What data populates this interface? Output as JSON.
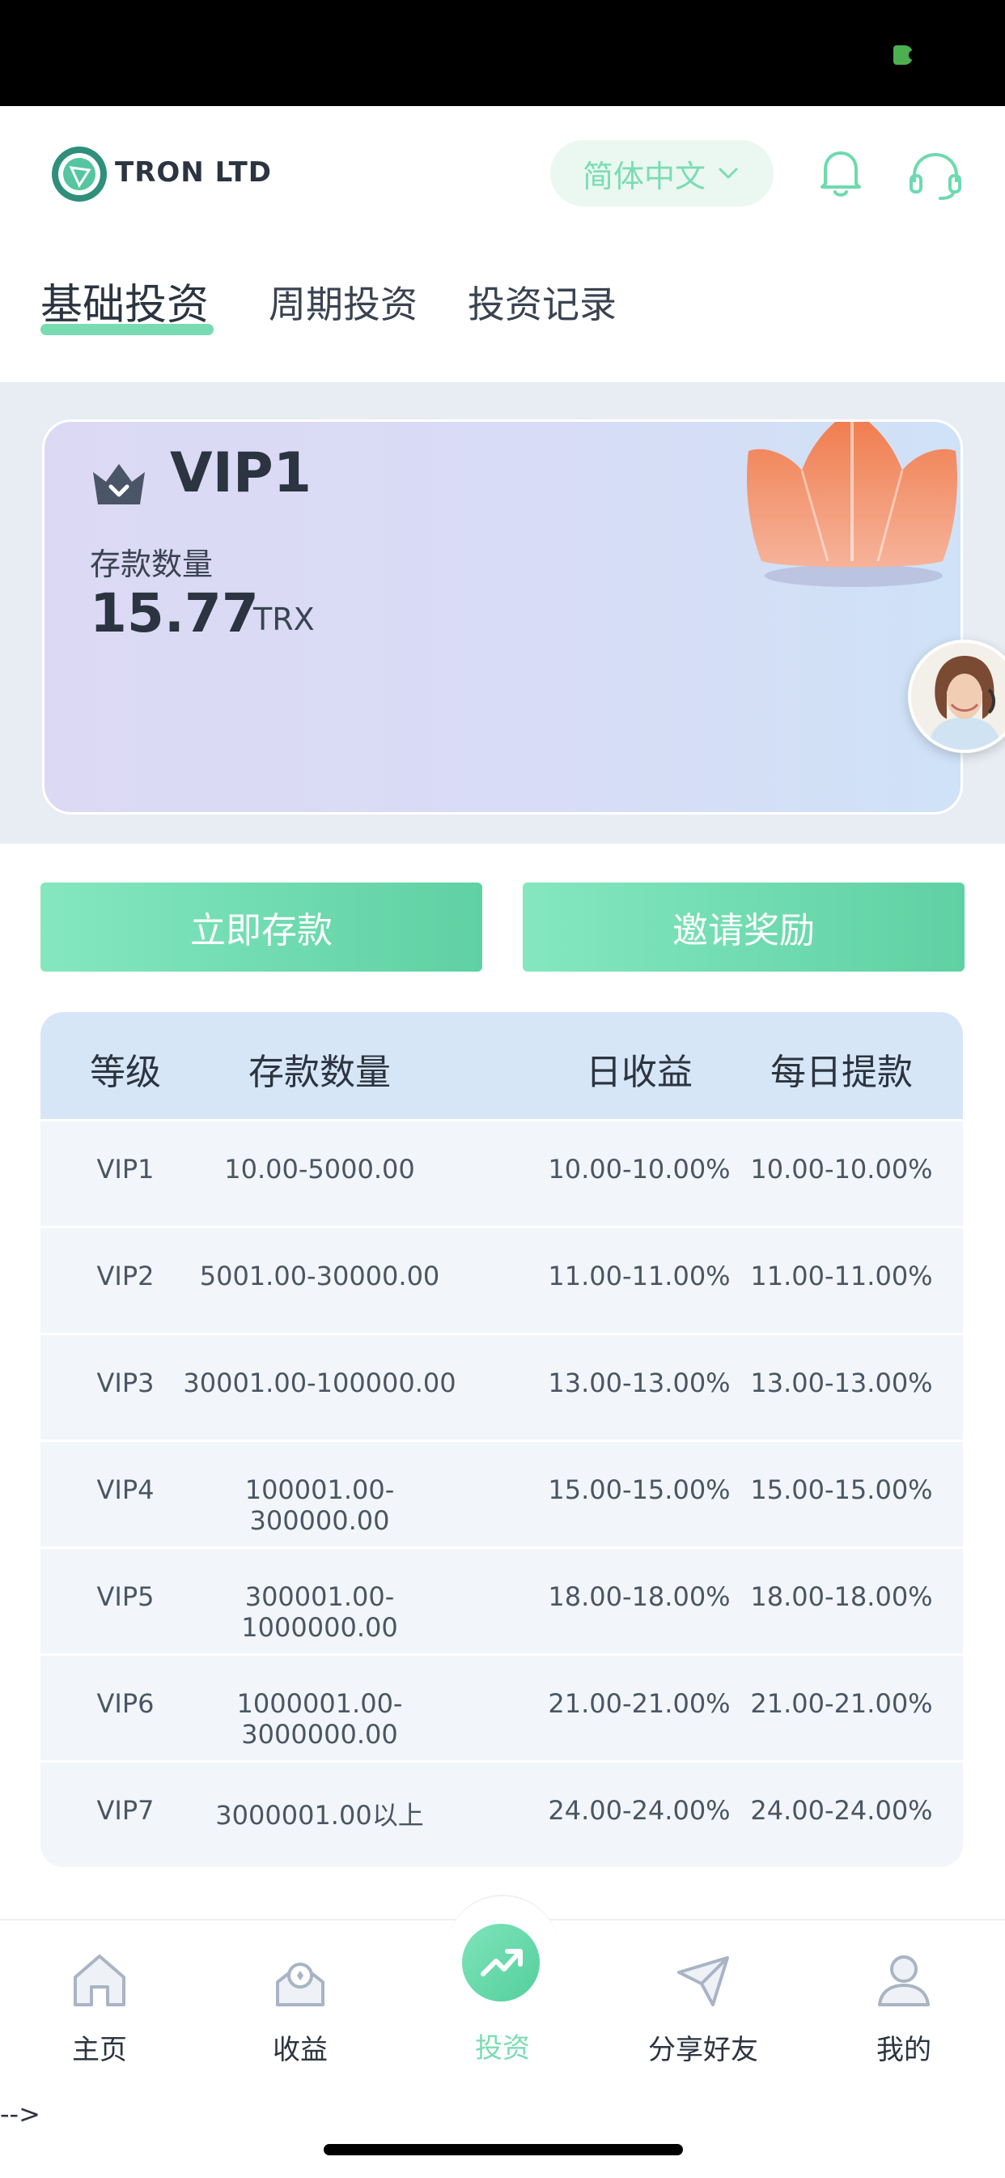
{
  "header": {
    "brand": "TRON LTD",
    "language": "简体中文"
  },
  "tabs": [
    {
      "label": "基础投资",
      "active": true
    },
    {
      "label": "周期投资",
      "active": false
    },
    {
      "label": "投资记录",
      "active": false
    }
  ],
  "card": {
    "level": "VIP1",
    "deposit_label": "存款数量",
    "deposit_value": "15.77",
    "deposit_unit": "TRX"
  },
  "buttons": {
    "deposit": "立即存款",
    "invite": "邀请奖励"
  },
  "table": {
    "headers": [
      "等级",
      "存款数量",
      "日收益",
      "每日提款"
    ],
    "rows": [
      [
        "VIP1",
        "10.00-5000.00",
        "10.00-10.00%",
        "10.00-10.00%"
      ],
      [
        "VIP2",
        "5001.00-30000.00",
        "11.00-11.00%",
        "11.00-11.00%"
      ],
      [
        "VIP3",
        "30001.00-100000.00",
        "13.00-13.00%",
        "13.00-13.00%"
      ],
      [
        "VIP4",
        "100001.00-300000.00",
        "15.00-15.00%",
        "15.00-15.00%"
      ],
      [
        "VIP5",
        "300001.00-1000000.00",
        "18.00-18.00%",
        "18.00-18.00%"
      ],
      [
        "VIP6",
        "1000001.00-3000000.00",
        "21.00-21.00%",
        "21.00-21.00%"
      ],
      [
        "VIP7",
        "3000001.00以上",
        "24.00-24.00%",
        "24.00-24.00%"
      ]
    ]
  },
  "nav": {
    "items": [
      {
        "label": "主页",
        "icon": "home-icon"
      },
      {
        "label": "收益",
        "icon": "earnings-icon"
      },
      {
        "label": "投资",
        "icon": "invest-icon",
        "active": true
      },
      {
        "label": "分享好友",
        "icon": "share-icon"
      },
      {
        "label": "我的",
        "icon": "profile-icon"
      }
    ]
  },
  "stray_text": "-->",
  "colors": {
    "accent": "#7bdcb5",
    "button": "#6edab0",
    "table_header": "#d7e6f6"
  }
}
